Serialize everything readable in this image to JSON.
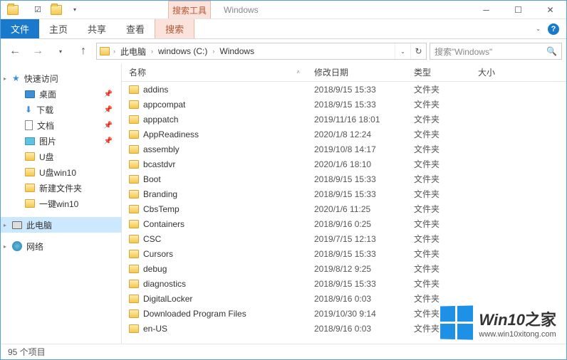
{
  "titlebar": {
    "search_tools_label": "搜索工具",
    "window_title": "Windows"
  },
  "ribbon": {
    "file": "文件",
    "home": "主页",
    "share": "共享",
    "view": "查看",
    "search": "搜索"
  },
  "addressbar": {
    "segments": [
      "此电脑",
      "windows (C:)",
      "Windows"
    ]
  },
  "searchbox": {
    "placeholder": "搜索\"Windows\""
  },
  "navpane": {
    "quick_access": "快速访问",
    "items": [
      {
        "label": "桌面",
        "pinned": true,
        "icon": "desktop"
      },
      {
        "label": "下载",
        "pinned": true,
        "icon": "download"
      },
      {
        "label": "文档",
        "pinned": true,
        "icon": "document"
      },
      {
        "label": "图片",
        "pinned": true,
        "icon": "picture"
      },
      {
        "label": "U盘",
        "pinned": false,
        "icon": "folder"
      },
      {
        "label": "U盘win10",
        "pinned": false,
        "icon": "folder"
      },
      {
        "label": "新建文件夹",
        "pinned": false,
        "icon": "folder"
      },
      {
        "label": "一键win10",
        "pinned": false,
        "icon": "folder"
      }
    ],
    "this_pc": "此电脑",
    "network": "网络"
  },
  "columns": {
    "name": "名称",
    "date": "修改日期",
    "type": "类型",
    "size": "大小"
  },
  "files": [
    {
      "name": "addins",
      "date": "2018/9/15 15:33",
      "type": "文件夹"
    },
    {
      "name": "appcompat",
      "date": "2018/9/15 15:33",
      "type": "文件夹"
    },
    {
      "name": "apppatch",
      "date": "2019/11/16 18:01",
      "type": "文件夹"
    },
    {
      "name": "AppReadiness",
      "date": "2020/1/8 12:24",
      "type": "文件夹"
    },
    {
      "name": "assembly",
      "date": "2019/10/8 14:17",
      "type": "文件夹"
    },
    {
      "name": "bcastdvr",
      "date": "2020/1/6 18:10",
      "type": "文件夹"
    },
    {
      "name": "Boot",
      "date": "2018/9/15 15:33",
      "type": "文件夹"
    },
    {
      "name": "Branding",
      "date": "2018/9/15 15:33",
      "type": "文件夹"
    },
    {
      "name": "CbsTemp",
      "date": "2020/1/6 11:25",
      "type": "文件夹"
    },
    {
      "name": "Containers",
      "date": "2018/9/16 0:25",
      "type": "文件夹"
    },
    {
      "name": "CSC",
      "date": "2019/7/15 12:13",
      "type": "文件夹"
    },
    {
      "name": "Cursors",
      "date": "2018/9/15 15:33",
      "type": "文件夹"
    },
    {
      "name": "debug",
      "date": "2019/8/12 9:25",
      "type": "文件夹"
    },
    {
      "name": "diagnostics",
      "date": "2018/9/15 15:33",
      "type": "文件夹"
    },
    {
      "name": "DigitalLocker",
      "date": "2018/9/16 0:03",
      "type": "文件夹"
    },
    {
      "name": "Downloaded Program Files",
      "date": "2019/10/30 9:14",
      "type": "文件夹"
    },
    {
      "name": "en-US",
      "date": "2018/9/16 0:03",
      "type": "文件夹"
    }
  ],
  "status": {
    "item_count": "95 个项目"
  },
  "watermark": {
    "brand_en": "Win10",
    "brand_zh": "之家",
    "url": "www.win10xitong.com"
  }
}
